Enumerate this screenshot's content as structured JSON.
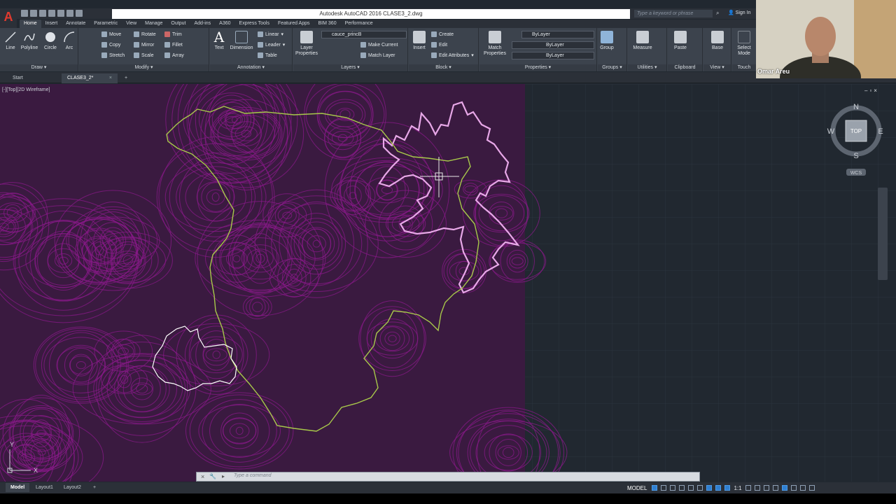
{
  "app": {
    "title": "Autodesk AutoCAD 2016    CLASE3_2.dwg",
    "search_placeholder": "Type a keyword or phrase",
    "sign_in": "Sign In"
  },
  "ribbon_tabs": [
    "Home",
    "Insert",
    "Annotate",
    "Parametric",
    "View",
    "Manage",
    "Output",
    "Add-ins",
    "A360",
    "Express Tools",
    "Featured Apps",
    "BIM 360",
    "Performance"
  ],
  "draw": {
    "line": "Line",
    "polyline": "Polyline",
    "circle": "Circle",
    "arc": "Arc",
    "title": "Draw"
  },
  "modify": {
    "move": "Move",
    "rotate": "Rotate",
    "trim": "Trim",
    "copy": "Copy",
    "mirror": "Mirror",
    "fillet": "Fillet",
    "stretch": "Stretch",
    "scale": "Scale",
    "array": "Array",
    "title": "Modify"
  },
  "annotation": {
    "text": "Text",
    "dimension": "Dimension",
    "linear": "Linear",
    "leader": "Leader",
    "table": "Table",
    "title": "Annotation"
  },
  "layers": {
    "layer_properties": "Layer Properties",
    "current_layer": "cauce_princB",
    "make_current": "Make Current",
    "match_layer": "Match Layer",
    "title": "Layers"
  },
  "block": {
    "insert": "Insert",
    "create": "Create",
    "edit": "Edit",
    "edit_attributes": "Edit Attributes",
    "title": "Block"
  },
  "properties": {
    "match_properties": "Match Properties",
    "color": "ByLayer",
    "linetype": "ByLayer",
    "lineweight": "ByLayer",
    "title": "Properties"
  },
  "groups": {
    "group": "Group",
    "title": "Groups"
  },
  "utilities": {
    "measure": "Measure",
    "title": "Utilities"
  },
  "clipboard": {
    "paste": "Paste",
    "title": "Clipboard"
  },
  "view_panel": {
    "base": "Base",
    "title": "View"
  },
  "touch": {
    "select_mode": "Select Mode",
    "title": "Touch"
  },
  "file_tabs": {
    "start": "Start",
    "current": "CLASE3_2*"
  },
  "viewport_label": "[-][Top][2D Wireframe]",
  "viewcube": {
    "n": "N",
    "s": "S",
    "e": "E",
    "w": "W",
    "face": "TOP",
    "wcs": "WCS"
  },
  "ucs": {
    "x": "X",
    "y": "Y"
  },
  "command_placeholder": "Type  a  command",
  "layout_tabs": [
    "Model",
    "Layout1",
    "Layout2"
  ],
  "status": {
    "space": "MODEL",
    "scale": "1:1"
  },
  "webcam": {
    "name": "Omar Areu"
  },
  "colors": {
    "topo": "#8a1a8a",
    "boundary": "#a8c84a",
    "watershed": "#e8a8e8",
    "island": "#ffffff",
    "background": "#212830"
  }
}
